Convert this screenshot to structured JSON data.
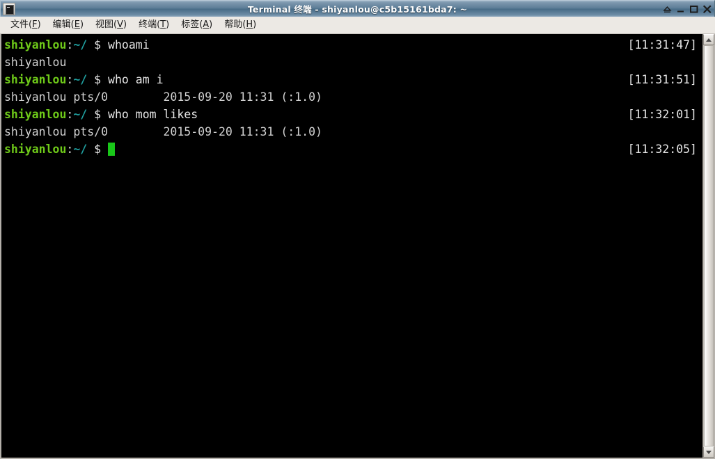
{
  "window": {
    "title": "Terminal 终端 - shiyanlou@c5b15161bda7: ~",
    "icon": "terminal-icon",
    "buttons": [
      {
        "name": "shade-button",
        "label": "▲"
      },
      {
        "name": "minimize-button",
        "label": "_"
      },
      {
        "name": "maximize-button",
        "label": "□"
      },
      {
        "name": "close-button",
        "label": "✕"
      }
    ]
  },
  "menubar": {
    "items": [
      {
        "name": "menu-file",
        "text": "文件(",
        "key": "F",
        "tail": ")"
      },
      {
        "name": "menu-edit",
        "text": "编辑(",
        "key": "E",
        "tail": ")"
      },
      {
        "name": "menu-view",
        "text": "视图(",
        "key": "V",
        "tail": ")"
      },
      {
        "name": "menu-terminal",
        "text": "终端(",
        "key": "T",
        "tail": ")"
      },
      {
        "name": "menu-tabs",
        "text": "标签(",
        "key": "A",
        "tail": ")"
      },
      {
        "name": "menu-help",
        "text": "帮助(",
        "key": "H",
        "tail": ")"
      }
    ]
  },
  "terminal": {
    "prompt": {
      "user": "shiyanlou",
      "colon": ":",
      "path": "~/",
      "dollar": " $ "
    },
    "lines": [
      {
        "type": "prompt",
        "command": "whoami",
        "timestamp": "[11:31:47]"
      },
      {
        "type": "output",
        "text": "shiyanlou"
      },
      {
        "type": "prompt",
        "command": "who am i",
        "timestamp": "[11:31:51]"
      },
      {
        "type": "output",
        "text": "shiyanlou pts/0        2015-09-20 11:31 (:1.0)"
      },
      {
        "type": "prompt",
        "command": "who mom likes",
        "timestamp": "[11:32:01]"
      },
      {
        "type": "output",
        "text": "shiyanlou pts/0        2015-09-20 11:31 (:1.0)"
      },
      {
        "type": "prompt",
        "command": "",
        "timestamp": "[11:32:05]",
        "cursor": true
      }
    ]
  },
  "colors": {
    "background": "#000000",
    "foreground": "#d9d9d9",
    "prompt_user": "#6ec919",
    "prompt_path": "#1f9e9e",
    "cursor": "#19c719",
    "titlebar": "#4c7290",
    "menubar": "#ece9e4"
  }
}
